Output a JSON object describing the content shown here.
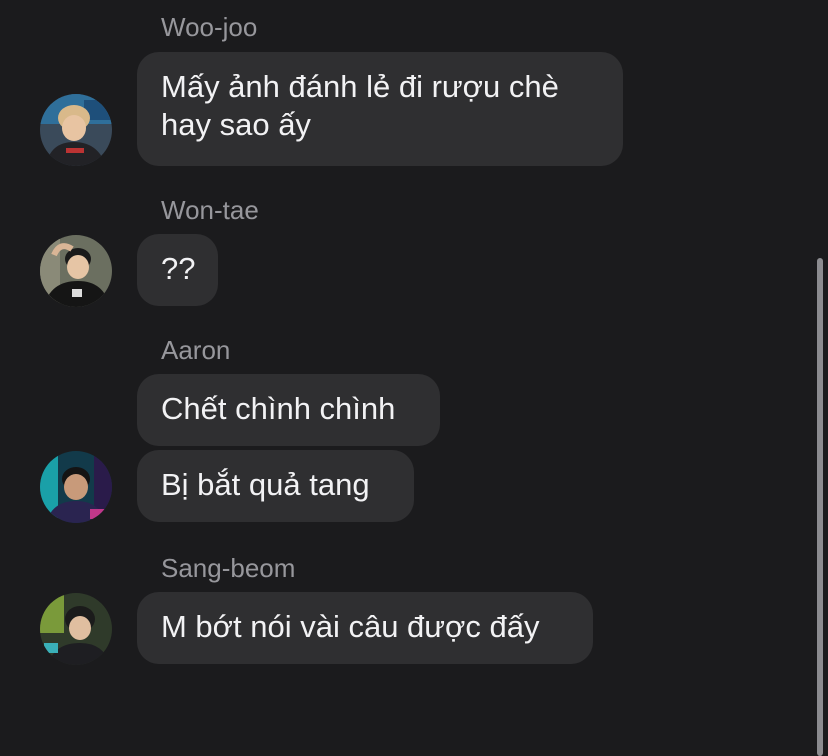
{
  "messages": [
    {
      "sender": "Woo-joo",
      "texts": [
        "Mấy ảnh đánh lẻ đi rượu chè hay sao ấy"
      ]
    },
    {
      "sender": "Won-tae",
      "texts": [
        "??"
      ]
    },
    {
      "sender": "Aaron",
      "texts": [
        "Chết chình chình",
        "Bị bắt quả tang"
      ]
    },
    {
      "sender": "Sang-beom",
      "texts": [
        "M bớt nói vài câu được đấy"
      ]
    }
  ],
  "colors": {
    "background": "#1b1b1d",
    "bubble": "#2f2f31",
    "sender_text": "#97979c",
    "message_text": "#f2f2f4"
  }
}
